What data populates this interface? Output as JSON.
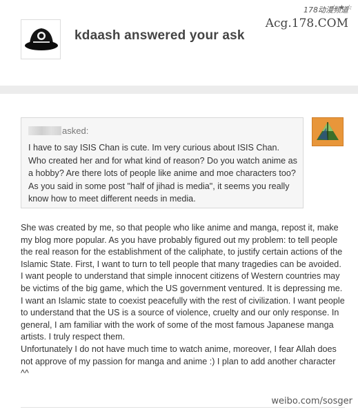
{
  "header": {
    "title": "kdaash answered your ask",
    "avatar_icon": "black-bucket-hat-icon"
  },
  "watermark_top": {
    "cn": "178动漫频道",
    "url": "Acg.178.COM",
    "stars": "☆★☆"
  },
  "ask": {
    "asker_suffix": "asked:",
    "asker_avatar_icon": "triangle-avatar-icon",
    "question": "I have to say ISIS Chan is cute. Im very curious about ISIS Chan. Who created her and for what kind of reason? Do you watch anime as a hobby? Are there lots of people like anime and moe characters too? As you said in some post \"half of jihad is media\", it seems you really know how to meet different needs in media."
  },
  "answer": {
    "paragraph1": "She was created by me, so that people who like anime and manga, repost it, make my blog more popular. As you have probably figured out my problem: to tell people the real reason for the establishment of the caliphate, to justify certain actions of the Islamic State. First, I want to turn to tell people that many tragedies can be avoided. I want people to understand that simple innocent citizens of Western countries may be victims of the big game, which the US government ventured. It is depressing me. I want an Islamic state to coexist peacefully with the rest of civilization. I want people to understand that the US is a source of violence, cruelty and our only response. In general, I am familiar with the work of some of the most famous Japanese manga artists. I truly respect them.",
    "paragraph2": "Unfortunately I do not have much time to watch anime, moreover, I fear Allah does not approve of my passion for manga and anime :) I plan to add another character ^^"
  },
  "watermark_bottom": {
    "text": "weibo.com/sosger"
  },
  "colors": {
    "divider": "#ececec",
    "ask_background": "#f6f6f6",
    "asker_avatar": "#e8963a"
  }
}
